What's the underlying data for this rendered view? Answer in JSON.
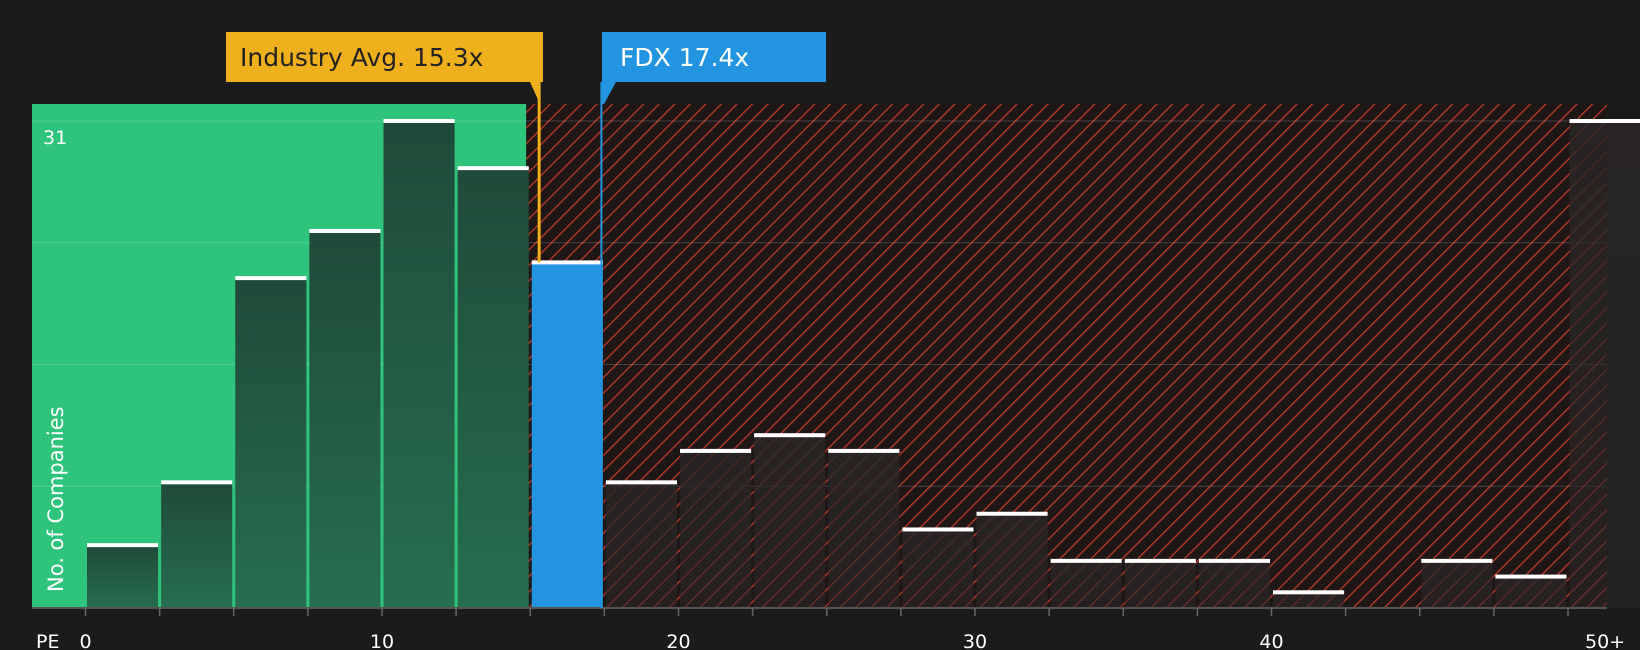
{
  "colors": {
    "background": "#1b1b1b",
    "undervalued_zone": "#2ec47b",
    "overvalued_hatch": "#c0392b",
    "industry_badge": "#efb01d",
    "company_badge": "#2394e0",
    "bar_dark": "#1e3b31",
    "bar_red_dark": "#2a1f1f",
    "bar_cap": "#ffffff"
  },
  "chart_data": {
    "type": "bar",
    "title": "",
    "xlabel": "PE",
    "ylabel": "No. of Companies",
    "ylim": [
      0,
      31
    ],
    "ymax_label": "31",
    "grid": true,
    "bin_width": 2.5,
    "x_ticks": [
      {
        "value": 0,
        "label": "0"
      },
      {
        "value": 10,
        "label": "10"
      },
      {
        "value": 20,
        "label": "20"
      },
      {
        "value": 30,
        "label": "30"
      },
      {
        "value": 40,
        "label": "40"
      },
      {
        "value": 51.25,
        "label": "50+"
      }
    ],
    "bins": [
      {
        "start": 0.0,
        "end": 2.5,
        "value": 4,
        "zone": "under"
      },
      {
        "start": 2.5,
        "end": 5.0,
        "value": 8,
        "zone": "under"
      },
      {
        "start": 5.0,
        "end": 7.5,
        "value": 21,
        "zone": "under"
      },
      {
        "start": 7.5,
        "end": 10.0,
        "value": 24,
        "zone": "under"
      },
      {
        "start": 10.0,
        "end": 12.5,
        "value": 31,
        "zone": "under"
      },
      {
        "start": 12.5,
        "end": 15.0,
        "value": 28,
        "zone": "under"
      },
      {
        "start": 15.0,
        "end": 17.5,
        "value": 22,
        "zone": "company"
      },
      {
        "start": 17.5,
        "end": 20.0,
        "value": 8,
        "zone": "over"
      },
      {
        "start": 20.0,
        "end": 22.5,
        "value": 10,
        "zone": "over"
      },
      {
        "start": 22.5,
        "end": 25.0,
        "value": 11,
        "zone": "over"
      },
      {
        "start": 25.0,
        "end": 27.5,
        "value": 10,
        "zone": "over"
      },
      {
        "start": 27.5,
        "end": 30.0,
        "value": 5,
        "zone": "over"
      },
      {
        "start": 30.0,
        "end": 32.5,
        "value": 6,
        "zone": "over"
      },
      {
        "start": 32.5,
        "end": 35.0,
        "value": 3,
        "zone": "over"
      },
      {
        "start": 35.0,
        "end": 37.5,
        "value": 3,
        "zone": "over"
      },
      {
        "start": 37.5,
        "end": 40.0,
        "value": 3,
        "zone": "over"
      },
      {
        "start": 40.0,
        "end": 42.5,
        "value": 1,
        "zone": "over"
      },
      {
        "start": 45.0,
        "end": 47.5,
        "value": 3,
        "zone": "over"
      },
      {
        "start": 47.5,
        "end": 50.0,
        "value": 2,
        "zone": "over"
      },
      {
        "start": 50.0,
        "end": 52.5,
        "value": 31,
        "zone": "over"
      }
    ],
    "industry_avg": {
      "value": 15.3,
      "label": "Industry Avg. 15.3x"
    },
    "company": {
      "value": 17.4,
      "label": "FDX 17.4x"
    }
  }
}
